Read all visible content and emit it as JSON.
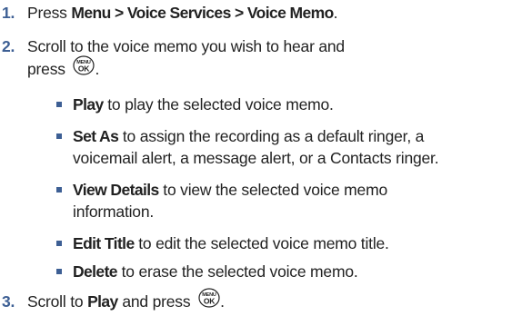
{
  "steps": [
    {
      "number": "1.",
      "prefix": "Press ",
      "bold": "Menu > Voice Services > Voice Memo",
      "suffix": "."
    },
    {
      "number": "2.",
      "line1": "Scroll to the voice memo you wish to hear and",
      "line2_prefix": "press ",
      "line2_suffix": "."
    },
    {
      "number": "3.",
      "prefix": "Scroll to ",
      "bold": "Play",
      "middle": " and press ",
      "suffix": "."
    }
  ],
  "options": [
    {
      "label": "Play",
      "text": " to play the selected voice memo."
    },
    {
      "label": "Set As",
      "text": "  to assign the recording as a default ringer, a",
      "continuation": "voicemail alert, a message alert, or a Contacts ringer."
    },
    {
      "label": "View Details",
      "text": " to view the selected voice memo",
      "continuation": "information."
    },
    {
      "label": "Edit Title",
      "text": " to edit the selected voice memo title."
    },
    {
      "label": "Delete",
      "text": " to erase the selected voice memo."
    }
  ],
  "menu_key": {
    "top_label": "MENU",
    "bottom_label": "OK"
  },
  "colors": {
    "accent": "#3d5f94",
    "text": "#222222"
  }
}
